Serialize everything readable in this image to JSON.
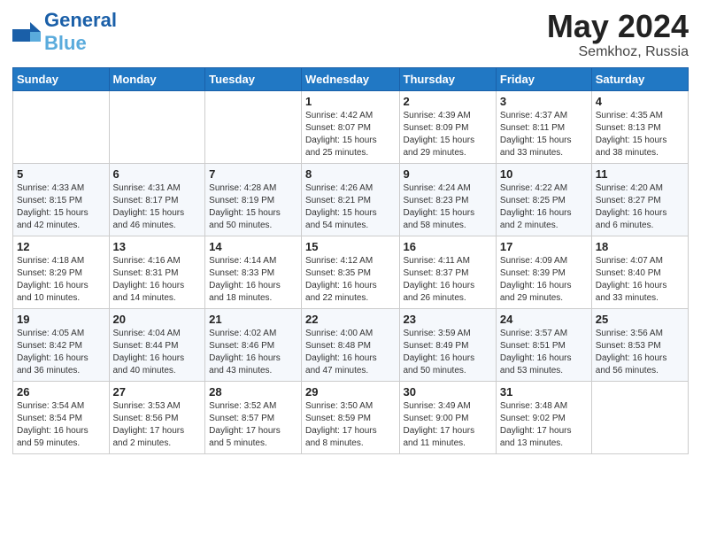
{
  "header": {
    "logo_general": "General",
    "logo_blue": "Blue",
    "main_title": "May 2024",
    "subtitle": "Semkhoz, Russia"
  },
  "calendar": {
    "columns": [
      "Sunday",
      "Monday",
      "Tuesday",
      "Wednesday",
      "Thursday",
      "Friday",
      "Saturday"
    ],
    "rows": [
      [
        {
          "day": "",
          "info": ""
        },
        {
          "day": "",
          "info": ""
        },
        {
          "day": "",
          "info": ""
        },
        {
          "day": "1",
          "info": "Sunrise: 4:42 AM\nSunset: 8:07 PM\nDaylight: 15 hours\nand 25 minutes."
        },
        {
          "day": "2",
          "info": "Sunrise: 4:39 AM\nSunset: 8:09 PM\nDaylight: 15 hours\nand 29 minutes."
        },
        {
          "day": "3",
          "info": "Sunrise: 4:37 AM\nSunset: 8:11 PM\nDaylight: 15 hours\nand 33 minutes."
        },
        {
          "day": "4",
          "info": "Sunrise: 4:35 AM\nSunset: 8:13 PM\nDaylight: 15 hours\nand 38 minutes."
        }
      ],
      [
        {
          "day": "5",
          "info": "Sunrise: 4:33 AM\nSunset: 8:15 PM\nDaylight: 15 hours\nand 42 minutes."
        },
        {
          "day": "6",
          "info": "Sunrise: 4:31 AM\nSunset: 8:17 PM\nDaylight: 15 hours\nand 46 minutes."
        },
        {
          "day": "7",
          "info": "Sunrise: 4:28 AM\nSunset: 8:19 PM\nDaylight: 15 hours\nand 50 minutes."
        },
        {
          "day": "8",
          "info": "Sunrise: 4:26 AM\nSunset: 8:21 PM\nDaylight: 15 hours\nand 54 minutes."
        },
        {
          "day": "9",
          "info": "Sunrise: 4:24 AM\nSunset: 8:23 PM\nDaylight: 15 hours\nand 58 minutes."
        },
        {
          "day": "10",
          "info": "Sunrise: 4:22 AM\nSunset: 8:25 PM\nDaylight: 16 hours\nand 2 minutes."
        },
        {
          "day": "11",
          "info": "Sunrise: 4:20 AM\nSunset: 8:27 PM\nDaylight: 16 hours\nand 6 minutes."
        }
      ],
      [
        {
          "day": "12",
          "info": "Sunrise: 4:18 AM\nSunset: 8:29 PM\nDaylight: 16 hours\nand 10 minutes."
        },
        {
          "day": "13",
          "info": "Sunrise: 4:16 AM\nSunset: 8:31 PM\nDaylight: 16 hours\nand 14 minutes."
        },
        {
          "day": "14",
          "info": "Sunrise: 4:14 AM\nSunset: 8:33 PM\nDaylight: 16 hours\nand 18 minutes."
        },
        {
          "day": "15",
          "info": "Sunrise: 4:12 AM\nSunset: 8:35 PM\nDaylight: 16 hours\nand 22 minutes."
        },
        {
          "day": "16",
          "info": "Sunrise: 4:11 AM\nSunset: 8:37 PM\nDaylight: 16 hours\nand 26 minutes."
        },
        {
          "day": "17",
          "info": "Sunrise: 4:09 AM\nSunset: 8:39 PM\nDaylight: 16 hours\nand 29 minutes."
        },
        {
          "day": "18",
          "info": "Sunrise: 4:07 AM\nSunset: 8:40 PM\nDaylight: 16 hours\nand 33 minutes."
        }
      ],
      [
        {
          "day": "19",
          "info": "Sunrise: 4:05 AM\nSunset: 8:42 PM\nDaylight: 16 hours\nand 36 minutes."
        },
        {
          "day": "20",
          "info": "Sunrise: 4:04 AM\nSunset: 8:44 PM\nDaylight: 16 hours\nand 40 minutes."
        },
        {
          "day": "21",
          "info": "Sunrise: 4:02 AM\nSunset: 8:46 PM\nDaylight: 16 hours\nand 43 minutes."
        },
        {
          "day": "22",
          "info": "Sunrise: 4:00 AM\nSunset: 8:48 PM\nDaylight: 16 hours\nand 47 minutes."
        },
        {
          "day": "23",
          "info": "Sunrise: 3:59 AM\nSunset: 8:49 PM\nDaylight: 16 hours\nand 50 minutes."
        },
        {
          "day": "24",
          "info": "Sunrise: 3:57 AM\nSunset: 8:51 PM\nDaylight: 16 hours\nand 53 minutes."
        },
        {
          "day": "25",
          "info": "Sunrise: 3:56 AM\nSunset: 8:53 PM\nDaylight: 16 hours\nand 56 minutes."
        }
      ],
      [
        {
          "day": "26",
          "info": "Sunrise: 3:54 AM\nSunset: 8:54 PM\nDaylight: 16 hours\nand 59 minutes."
        },
        {
          "day": "27",
          "info": "Sunrise: 3:53 AM\nSunset: 8:56 PM\nDaylight: 17 hours\nand 2 minutes."
        },
        {
          "day": "28",
          "info": "Sunrise: 3:52 AM\nSunset: 8:57 PM\nDaylight: 17 hours\nand 5 minutes."
        },
        {
          "day": "29",
          "info": "Sunrise: 3:50 AM\nSunset: 8:59 PM\nDaylight: 17 hours\nand 8 minutes."
        },
        {
          "day": "30",
          "info": "Sunrise: 3:49 AM\nSunset: 9:00 PM\nDaylight: 17 hours\nand 11 minutes."
        },
        {
          "day": "31",
          "info": "Sunrise: 3:48 AM\nSunset: 9:02 PM\nDaylight: 17 hours\nand 13 minutes."
        },
        {
          "day": "",
          "info": ""
        }
      ]
    ]
  }
}
